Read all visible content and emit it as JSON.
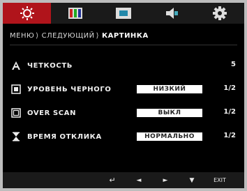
{
  "tabs": [
    {
      "name": "picture-tab",
      "icon": "sun-icon",
      "active": true
    },
    {
      "name": "color-tab",
      "icon": "color-bars-icon",
      "active": false
    },
    {
      "name": "display-tab",
      "icon": "display-icon",
      "active": false
    },
    {
      "name": "audio-tab",
      "icon": "speaker-icon",
      "active": false
    },
    {
      "name": "settings-tab",
      "icon": "gear-icon",
      "active": false
    }
  ],
  "breadcrumb": {
    "items": [
      "МЕНЮ",
      "СЛЕДУЮЩИЙ",
      "КАРТИНКА"
    ],
    "separator": "⟩"
  },
  "rows": [
    {
      "label": "ЧЕТКОСТЬ",
      "control": "slider",
      "level": 0.5,
      "value": "5",
      "icon": "sharpness-icon"
    },
    {
      "label": "УРОВЕНЬ ЧЕРНОГО",
      "control": "select",
      "option": "НИЗКИЙ",
      "value": "1/2",
      "icon": "black-level-icon"
    },
    {
      "label": "OVER SCAN",
      "control": "select",
      "option": "ВЫКЛ",
      "value": "1/2",
      "icon": "overscan-icon"
    },
    {
      "label": "ВРЕМЯ ОТКЛИКА",
      "control": "select",
      "option": "НОРМАЛЬНО",
      "value": "1/2",
      "icon": "hourglass-icon"
    }
  ],
  "nav": {
    "back": "↵",
    "left": "◄",
    "right": "►",
    "down": "▼",
    "exit": "EXIT"
  },
  "colors": {
    "active_tab": "#b0141b",
    "background": "#000000"
  }
}
